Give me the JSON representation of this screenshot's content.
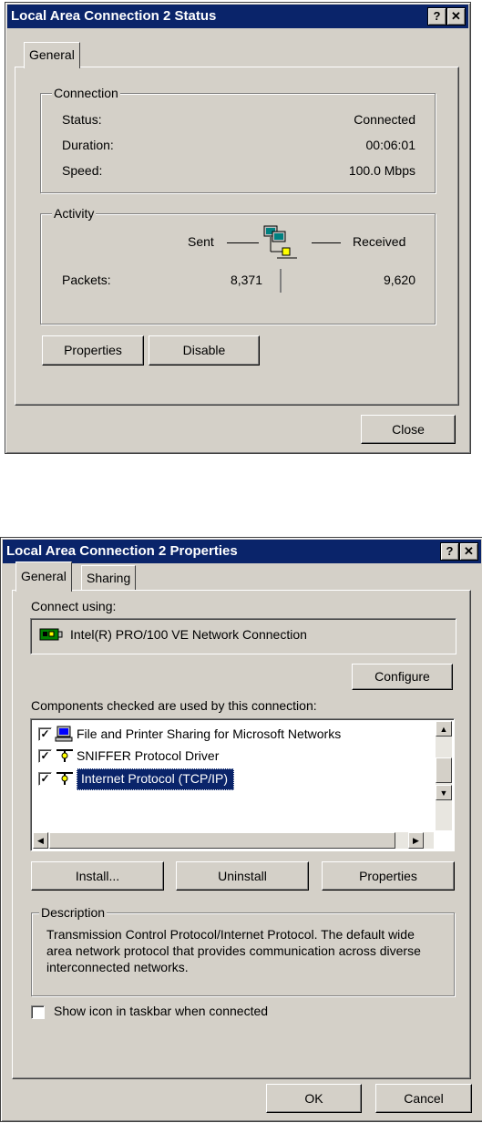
{
  "status_window": {
    "title": "Local Area Connection 2 Status",
    "help_label": "?",
    "close_glyph": "✕",
    "tab_general": "General",
    "connection": {
      "legend": "Connection",
      "status_label": "Status:",
      "status_value": "Connected",
      "duration_label": "Duration:",
      "duration_value": "00:06:01",
      "speed_label": "Speed:",
      "speed_value": "100.0 Mbps"
    },
    "activity": {
      "legend": "Activity",
      "sent_label": "Sent",
      "received_label": "Received",
      "packets_label": "Packets:",
      "packets_sent": "8,371",
      "packets_received": "9,620"
    },
    "properties_button": "Properties",
    "disable_button": "Disable",
    "close_button": "Close"
  },
  "properties_window": {
    "title": "Local Area Connection 2 Properties",
    "help_label": "?",
    "close_glyph": "✕",
    "tabs": [
      "General",
      "Sharing"
    ],
    "connect_using_label": "Connect using:",
    "adapter_name": "Intel(R) PRO/100 VE Network Connection",
    "configure_button": "Configure",
    "components_label": "Components checked are used by this connection:",
    "components": [
      {
        "label": "File and Printer Sharing for Microsoft Networks",
        "checked": true,
        "icon": "network-share-icon"
      },
      {
        "label": "SNIFFER Protocol Driver",
        "checked": true,
        "icon": "protocol-icon"
      },
      {
        "label": "Internet Protocol (TCP/IP)",
        "checked": true,
        "icon": "protocol-icon",
        "selected": true
      }
    ],
    "install_button": "Install...",
    "uninstall_button": "Uninstall",
    "properties_button": "Properties",
    "description": {
      "legend": "Description",
      "text": "Transmission Control Protocol/Internet Protocol. The default wide area network protocol that provides communication across diverse interconnected networks."
    },
    "show_icon_label": "Show icon in taskbar when connected",
    "show_icon_checked": false,
    "ok_button": "OK",
    "cancel_button": "Cancel"
  },
  "colors": {
    "title_bar": "#0a246a",
    "dialog_face": "#d4d0c8",
    "selection": "#0a246a"
  }
}
